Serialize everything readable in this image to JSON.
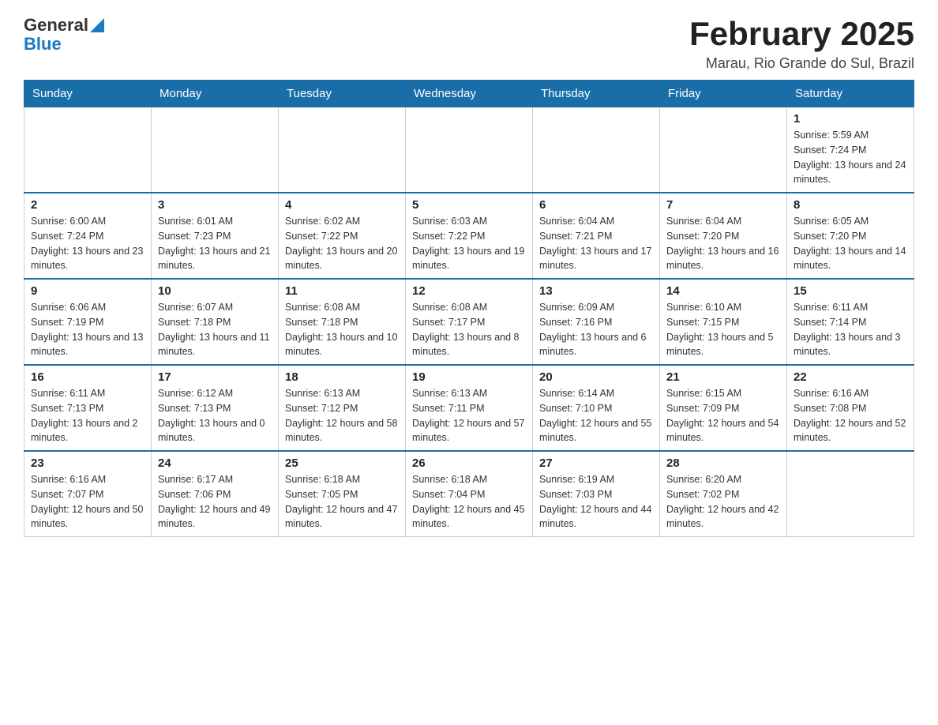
{
  "header": {
    "logo": {
      "general": "General",
      "blue": "Blue"
    },
    "title": "February 2025",
    "location": "Marau, Rio Grande do Sul, Brazil"
  },
  "days_of_week": [
    "Sunday",
    "Monday",
    "Tuesday",
    "Wednesday",
    "Thursday",
    "Friday",
    "Saturday"
  ],
  "weeks": [
    [
      {
        "day": "",
        "info": ""
      },
      {
        "day": "",
        "info": ""
      },
      {
        "day": "",
        "info": ""
      },
      {
        "day": "",
        "info": ""
      },
      {
        "day": "",
        "info": ""
      },
      {
        "day": "",
        "info": ""
      },
      {
        "day": "1",
        "info": "Sunrise: 5:59 AM\nSunset: 7:24 PM\nDaylight: 13 hours and 24 minutes."
      }
    ],
    [
      {
        "day": "2",
        "info": "Sunrise: 6:00 AM\nSunset: 7:24 PM\nDaylight: 13 hours and 23 minutes."
      },
      {
        "day": "3",
        "info": "Sunrise: 6:01 AM\nSunset: 7:23 PM\nDaylight: 13 hours and 21 minutes."
      },
      {
        "day": "4",
        "info": "Sunrise: 6:02 AM\nSunset: 7:22 PM\nDaylight: 13 hours and 20 minutes."
      },
      {
        "day": "5",
        "info": "Sunrise: 6:03 AM\nSunset: 7:22 PM\nDaylight: 13 hours and 19 minutes."
      },
      {
        "day": "6",
        "info": "Sunrise: 6:04 AM\nSunset: 7:21 PM\nDaylight: 13 hours and 17 minutes."
      },
      {
        "day": "7",
        "info": "Sunrise: 6:04 AM\nSunset: 7:20 PM\nDaylight: 13 hours and 16 minutes."
      },
      {
        "day": "8",
        "info": "Sunrise: 6:05 AM\nSunset: 7:20 PM\nDaylight: 13 hours and 14 minutes."
      }
    ],
    [
      {
        "day": "9",
        "info": "Sunrise: 6:06 AM\nSunset: 7:19 PM\nDaylight: 13 hours and 13 minutes."
      },
      {
        "day": "10",
        "info": "Sunrise: 6:07 AM\nSunset: 7:18 PM\nDaylight: 13 hours and 11 minutes."
      },
      {
        "day": "11",
        "info": "Sunrise: 6:08 AM\nSunset: 7:18 PM\nDaylight: 13 hours and 10 minutes."
      },
      {
        "day": "12",
        "info": "Sunrise: 6:08 AM\nSunset: 7:17 PM\nDaylight: 13 hours and 8 minutes."
      },
      {
        "day": "13",
        "info": "Sunrise: 6:09 AM\nSunset: 7:16 PM\nDaylight: 13 hours and 6 minutes."
      },
      {
        "day": "14",
        "info": "Sunrise: 6:10 AM\nSunset: 7:15 PM\nDaylight: 13 hours and 5 minutes."
      },
      {
        "day": "15",
        "info": "Sunrise: 6:11 AM\nSunset: 7:14 PM\nDaylight: 13 hours and 3 minutes."
      }
    ],
    [
      {
        "day": "16",
        "info": "Sunrise: 6:11 AM\nSunset: 7:13 PM\nDaylight: 13 hours and 2 minutes."
      },
      {
        "day": "17",
        "info": "Sunrise: 6:12 AM\nSunset: 7:13 PM\nDaylight: 13 hours and 0 minutes."
      },
      {
        "day": "18",
        "info": "Sunrise: 6:13 AM\nSunset: 7:12 PM\nDaylight: 12 hours and 58 minutes."
      },
      {
        "day": "19",
        "info": "Sunrise: 6:13 AM\nSunset: 7:11 PM\nDaylight: 12 hours and 57 minutes."
      },
      {
        "day": "20",
        "info": "Sunrise: 6:14 AM\nSunset: 7:10 PM\nDaylight: 12 hours and 55 minutes."
      },
      {
        "day": "21",
        "info": "Sunrise: 6:15 AM\nSunset: 7:09 PM\nDaylight: 12 hours and 54 minutes."
      },
      {
        "day": "22",
        "info": "Sunrise: 6:16 AM\nSunset: 7:08 PM\nDaylight: 12 hours and 52 minutes."
      }
    ],
    [
      {
        "day": "23",
        "info": "Sunrise: 6:16 AM\nSunset: 7:07 PM\nDaylight: 12 hours and 50 minutes."
      },
      {
        "day": "24",
        "info": "Sunrise: 6:17 AM\nSunset: 7:06 PM\nDaylight: 12 hours and 49 minutes."
      },
      {
        "day": "25",
        "info": "Sunrise: 6:18 AM\nSunset: 7:05 PM\nDaylight: 12 hours and 47 minutes."
      },
      {
        "day": "26",
        "info": "Sunrise: 6:18 AM\nSunset: 7:04 PM\nDaylight: 12 hours and 45 minutes."
      },
      {
        "day": "27",
        "info": "Sunrise: 6:19 AM\nSunset: 7:03 PM\nDaylight: 12 hours and 44 minutes."
      },
      {
        "day": "28",
        "info": "Sunrise: 6:20 AM\nSunset: 7:02 PM\nDaylight: 12 hours and 42 minutes."
      },
      {
        "day": "",
        "info": ""
      }
    ]
  ]
}
